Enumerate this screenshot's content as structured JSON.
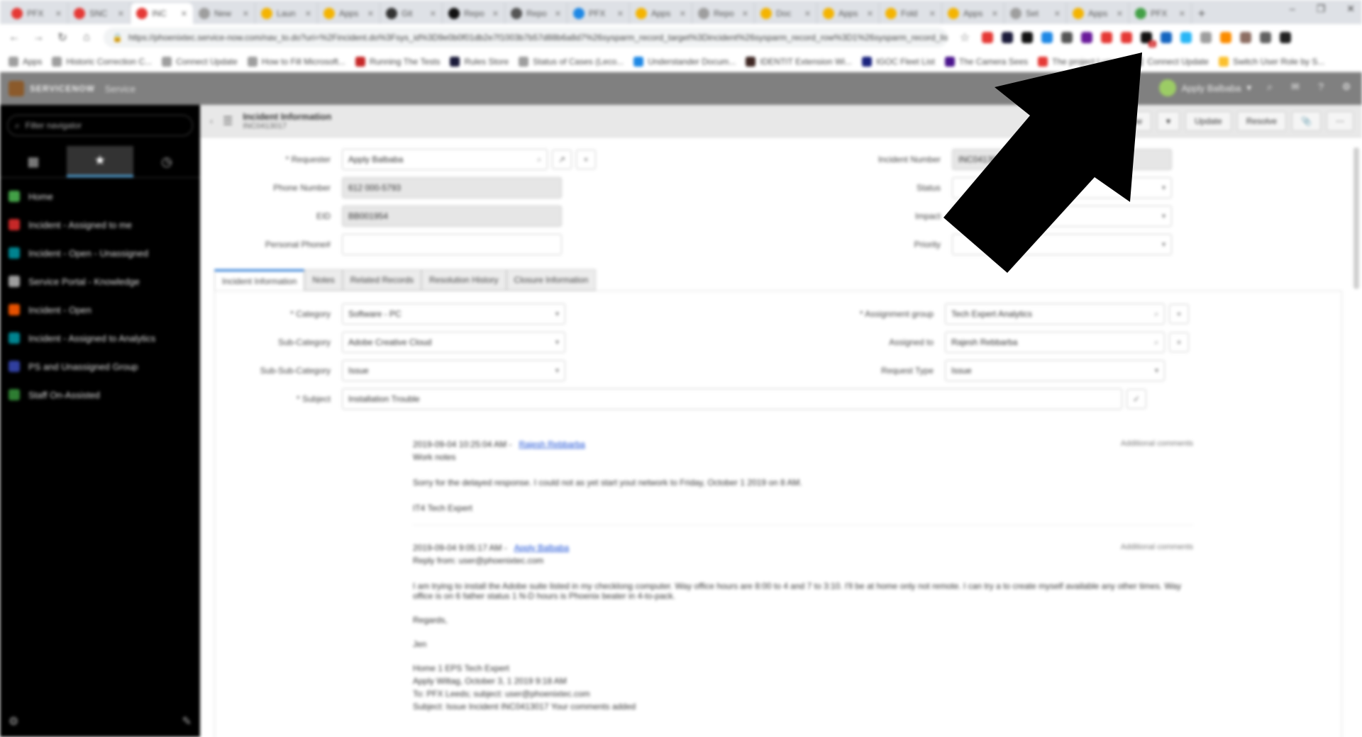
{
  "browser": {
    "tabs": [
      {
        "label": "PFX",
        "color": "#e53935"
      },
      {
        "label": "SNC",
        "color": "#e53935"
      },
      {
        "label": "INC",
        "color": "#e53935",
        "active": true
      },
      {
        "label": "New",
        "color": "#9e9e9e"
      },
      {
        "label": "Laun",
        "color": "#f4b400"
      },
      {
        "label": "Apps",
        "color": "#f4b400"
      },
      {
        "label": "Git",
        "color": "#333333"
      },
      {
        "label": "Repo",
        "color": "#111111"
      },
      {
        "label": "Repo",
        "color": "#555555"
      },
      {
        "label": "PFX",
        "color": "#1e88e5"
      },
      {
        "label": "Apps",
        "color": "#f4b400"
      },
      {
        "label": "Repo",
        "color": "#9e9e9e"
      },
      {
        "label": "Doc",
        "color": "#f4b400"
      },
      {
        "label": "Apps",
        "color": "#f4b400"
      },
      {
        "label": "Fold",
        "color": "#f4b400"
      },
      {
        "label": "Apps",
        "color": "#f4b400"
      },
      {
        "label": "Set",
        "color": "#9e9e9e"
      },
      {
        "label": "Apps",
        "color": "#f4b400"
      },
      {
        "label": "PFX",
        "color": "#43a047"
      }
    ],
    "new_tab": "+",
    "window": {
      "minimize": "–",
      "maximize": "❐",
      "close": "✕"
    },
    "url": "https://phoenixtec.service-now.com/nav_to.do?uri=%2Fincident.do%3Fsys_id%3D9e0b0f01db2e7f1003b7b57d88b6a8d7%26sysparm_record_target%3Dincident%26sysparm_record_row%3D1%26sysparm_record_list",
    "extensions": [
      {
        "name": "warning-ext-icon",
        "color": "#e53935"
      },
      {
        "name": "shield-ext-icon",
        "color": "#1b1b3a"
      },
      {
        "name": "puzzle-ext-icon",
        "color": "#111111"
      },
      {
        "name": "globe-ext-icon",
        "color": "#1e88e5"
      },
      {
        "name": "star-ext-icon",
        "color": "#555555"
      },
      {
        "name": "key-ext-icon",
        "color": "#6a1b9a"
      },
      {
        "name": "red-ext-icon",
        "color": "#e53935"
      },
      {
        "name": "pin-ext-icon",
        "color": "#e53935"
      },
      {
        "name": "camera-ext-icon",
        "color": "#111111",
        "badge": "1"
      },
      {
        "name": "cloud-ext-icon",
        "color": "#1565c0"
      },
      {
        "name": "bird-ext-icon",
        "color": "#29b6f6"
      },
      {
        "name": "gear-ext-icon",
        "color": "#9e9e9e"
      },
      {
        "name": "orange-ext-icon",
        "color": "#fb8c00"
      },
      {
        "name": "bolt-ext-icon",
        "color": "#8d6e63"
      },
      {
        "name": "puzzle2-ext-icon",
        "color": "#616161"
      },
      {
        "name": "profile-ext-icon",
        "color": "#222222"
      }
    ],
    "bookmarks": [
      {
        "label": "Apps",
        "color": "#9e9e9e"
      },
      {
        "label": "Historic Correction C...",
        "color": "#9e9e9e"
      },
      {
        "label": "Connect Update",
        "color": "#9e9e9e"
      },
      {
        "label": "How to Fill Microsoft...",
        "color": "#9e9e9e"
      },
      {
        "label": "Running The Tests",
        "color": "#c62828"
      },
      {
        "label": "Rules Store",
        "color": "#1b1b3a"
      },
      {
        "label": "Status of Cases (Leco...",
        "color": "#9e9e9e"
      },
      {
        "label": "Understander Docum...",
        "color": "#1e88e5"
      },
      {
        "label": "IDENTIT Extension Wi...",
        "color": "#3e2723"
      },
      {
        "label": "IGOC Fleet List",
        "color": "#1a237e"
      },
      {
        "label": "The Camera Sees",
        "color": "#4a148c"
      },
      {
        "label": "The project Lumen",
        "color": "#e53935"
      },
      {
        "label": "Connect Update",
        "color": "#9e9e9e"
      },
      {
        "label": "Switch User Role by S...",
        "color": "#fbc02d"
      }
    ]
  },
  "app": {
    "brand": "SERVICENOW",
    "subtitle": "Service",
    "user_name": "Apply Balbaba",
    "header_icons": [
      "search-icon",
      "chat-icon",
      "help-icon",
      "gear-icon"
    ]
  },
  "leftnav": {
    "filter_placeholder": "Filter navigator",
    "tabs": [
      "all-apps",
      "favorites",
      "history"
    ],
    "items": [
      {
        "label": "Home",
        "color": "#43a047"
      },
      {
        "label": "Incident - Assigned to me",
        "color": "#c62828"
      },
      {
        "label": "Incident - Open - Unassigned",
        "color": "#00838f"
      },
      {
        "label": "Service Portal - Knowledge",
        "color": "#9e9e9e"
      },
      {
        "label": "Incident - Open",
        "color": "#e65100"
      },
      {
        "label": "Incident - Assigned to Analytics",
        "color": "#00838f"
      },
      {
        "label": "PS and Unassigned Group",
        "color": "#303f9f"
      },
      {
        "label": "Staff On-Assisted",
        "color": "#2e7d32"
      }
    ]
  },
  "form": {
    "title": "Incident Information",
    "subtitle": "INC0413017",
    "buttons": [
      "Follow",
      "▾",
      "Update",
      "Resolve"
    ],
    "left_fields": [
      {
        "label": "* Requester",
        "value": "Apply Balbaba",
        "readonly": false,
        "icons": [
          "search-icon",
          "reference-icon",
          "add-icon"
        ]
      },
      {
        "label": "Phone Number",
        "value": "612 000-5793",
        "readonly": true
      },
      {
        "label": "EID",
        "value": "BB001954",
        "readonly": true
      },
      {
        "label": "Personal Phone#",
        "value": "",
        "readonly": false
      }
    ],
    "right_fields": [
      {
        "label": "Incident Number",
        "value": "INC0413017",
        "readonly": true
      },
      {
        "label": "Status",
        "value": "",
        "select": true
      },
      {
        "label": "Impact",
        "value": "",
        "select": true
      },
      {
        "label": "Priority",
        "value": "",
        "select": true
      }
    ],
    "tabs": [
      "Incident Information",
      "Notes",
      "Related Records",
      "Resolution History",
      "Closure Information"
    ],
    "detail_left": [
      {
        "label": "* Category",
        "value": "Software - PC",
        "select": true
      },
      {
        "label": "Sub-Category",
        "value": "Adobe Creative Cloud",
        "select": true
      },
      {
        "label": "Sub-Sub-Category",
        "value": "Issue",
        "select": true
      }
    ],
    "detail_right": [
      {
        "label": "* Assignment group",
        "value": "Tech Expert Analytics",
        "icons": [
          "search-icon",
          "add-icon"
        ]
      },
      {
        "label": "Assigned to",
        "value": "Rajesh Rebbarba",
        "icons": [
          "search-icon",
          "add-icon"
        ]
      },
      {
        "label": "Request Type",
        "value": "Issue",
        "select": true
      }
    ],
    "subject": {
      "label": "* Subject",
      "value": "Installation Trouble"
    },
    "journal": [
      {
        "meta": "2019-09-04 10:25:04 AM - ",
        "author": "Rajesh Rebbarba",
        "kind": "Work notes",
        "time": "Additional comments",
        "lines": [
          "Sorry for the delayed response. I could not as yet start yout network to Friday, October 1 2019 on 8 AM.",
          "IT4 Tech Expert"
        ]
      },
      {
        "meta": "2019-09-04 9:05:17 AM - ",
        "author": "Apply Balbaba",
        "kind": "Reply from: user@phoenixtec.com",
        "time": "Additional comments",
        "lines": [
          "I am trying to install the Adobe suite listed in my checklong computer. Way office hours are 8:00 to 4 and 7 to 3:10. I'll be at home only not remote. I can try a to create myself available any other times. Way office is on 6 father status 1 N-D hours is Phoenix beater in 4-to-pack.",
          "Regards,",
          "Jen",
          "Home 1 EPS Tech Expert",
          "Apply Wiltag, October 3, 1 2019 9:18 AM",
          "To: PFX Leeds; subject: user@phoenixtec.com",
          "Subject: Issue Incident INC0413017 Your comments added"
        ]
      }
    ]
  }
}
